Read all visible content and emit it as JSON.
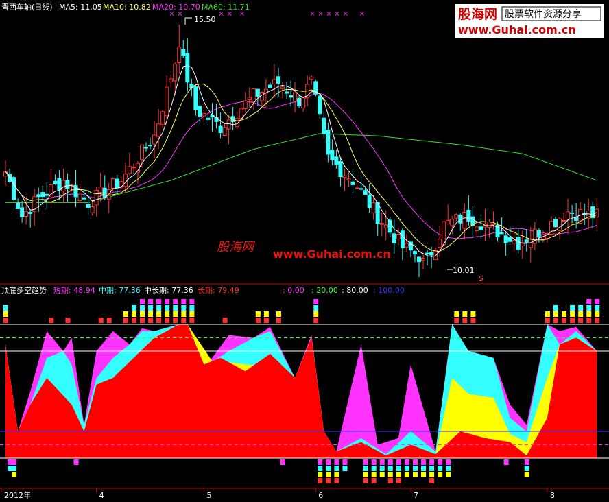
{
  "upper_panel": {
    "title": "晋西车轴(日线)",
    "ma_labels": [
      {
        "text": "MA5: 11.05",
        "color": "#ffffff"
      },
      {
        "text": "MA10: 10.82",
        "color": "#ffff66"
      },
      {
        "text": "MA20: 10.70",
        "color": "#ff33ff"
      },
      {
        "text": "MA60: 11.71",
        "color": "#33dd33"
      }
    ],
    "high_label": "15.50",
    "low_label": "10.01",
    "s_mark": "S",
    "marker_glyph": "×",
    "watermark": {
      "cn": "股海网",
      "url": "www.Guhai.com.cn"
    }
  },
  "logo": {
    "site": "股海网",
    "slogan": "股票软件资源分享",
    "url": "www.Guhai.com.cn"
  },
  "lower_panel": {
    "title": "顶底多空趋势",
    "labels": [
      {
        "text": "短期: 48.94",
        "color": "#ff33ff"
      },
      {
        "text": "中期: 77.36",
        "color": "#33ffff"
      },
      {
        "text": "中长期: 77.36",
        "color": "#ffffff"
      },
      {
        "text": "长期: 79.49",
        "color": "#ff3333"
      }
    ],
    "levels": [
      {
        "text": ": 0.00",
        "color": "#ff33ff"
      },
      {
        "text": ": 20.00",
        "color": "#33ff33"
      },
      {
        "text": ": 80.00",
        "color": "#ffffff"
      },
      {
        "text": ": 100.00",
        "color": "#3333ff"
      }
    ]
  },
  "x_axis": {
    "labels": [
      "2012年",
      "4",
      "5",
      "6",
      "7",
      "8"
    ],
    "label_index": [
      0,
      22,
      48,
      75,
      98,
      131
    ]
  },
  "chart_data": {
    "type": "candlestick",
    "bars": 144,
    "ohlc_anchors": [
      [
        0,
        12.2
      ],
      [
        4,
        11.2
      ],
      [
        8,
        11.6
      ],
      [
        14,
        12.0
      ],
      [
        20,
        11.5
      ],
      [
        28,
        12.0
      ],
      [
        36,
        13.0
      ],
      [
        42,
        15.0
      ],
      [
        46,
        13.6
      ],
      [
        52,
        13.2
      ],
      [
        60,
        13.9
      ],
      [
        66,
        14.2
      ],
      [
        71,
        13.8
      ],
      [
        74,
        14.2
      ],
      [
        78,
        12.5
      ],
      [
        84,
        12.0
      ],
      [
        90,
        11.2
      ],
      [
        96,
        10.5
      ],
      [
        102,
        10.2
      ],
      [
        106,
        11.0
      ],
      [
        112,
        11.2
      ],
      [
        118,
        10.9
      ],
      [
        124,
        10.6
      ],
      [
        130,
        10.9
      ],
      [
        136,
        11.3
      ],
      [
        143,
        11.2
      ]
    ],
    "ma60_anchors": [
      [
        0,
        11.5
      ],
      [
        20,
        11.5
      ],
      [
        40,
        12.0
      ],
      [
        60,
        12.7
      ],
      [
        76,
        13.05
      ],
      [
        90,
        13.0
      ],
      [
        110,
        12.8
      ],
      [
        125,
        12.6
      ],
      [
        143,
        12.0
      ]
    ],
    "oscillator_anchors": {
      "long": [
        [
          0,
          85
        ],
        [
          3,
          20
        ],
        [
          6,
          40
        ],
        [
          10,
          60
        ],
        [
          16,
          40
        ],
        [
          19,
          20
        ],
        [
          22,
          55
        ],
        [
          26,
          60
        ],
        [
          30,
          72
        ],
        [
          36,
          90
        ],
        [
          42,
          100
        ],
        [
          44,
          100
        ],
        [
          48,
          70
        ],
        [
          52,
          75
        ],
        [
          58,
          65
        ],
        [
          64,
          78
        ],
        [
          70,
          60
        ],
        [
          74,
          90
        ],
        [
          77,
          20
        ],
        [
          80,
          5
        ],
        [
          86,
          12
        ],
        [
          92,
          2
        ],
        [
          98,
          10
        ],
        [
          104,
          3
        ],
        [
          110,
          20
        ],
        [
          116,
          15
        ],
        [
          122,
          12
        ],
        [
          126,
          2
        ],
        [
          131,
          30
        ],
        [
          134,
          85
        ],
        [
          138,
          90
        ],
        [
          143,
          80
        ]
      ],
      "mid": [
        [
          0,
          85
        ],
        [
          3,
          20
        ],
        [
          6,
          40
        ],
        [
          10,
          75
        ],
        [
          14,
          80
        ],
        [
          16,
          70
        ],
        [
          19,
          25
        ],
        [
          22,
          60
        ],
        [
          26,
          75
        ],
        [
          30,
          85
        ],
        [
          33,
          95
        ],
        [
          36,
          95
        ],
        [
          42,
          100
        ],
        [
          44,
          100
        ],
        [
          50,
          72
        ],
        [
          54,
          80
        ],
        [
          60,
          90
        ],
        [
          64,
          95
        ],
        [
          70,
          60
        ],
        [
          74,
          90
        ],
        [
          77,
          20
        ],
        [
          80,
          5
        ],
        [
          86,
          15
        ],
        [
          92,
          3
        ],
        [
          98,
          20
        ],
        [
          104,
          5
        ],
        [
          108,
          100
        ],
        [
          112,
          80
        ],
        [
          118,
          75
        ],
        [
          122,
          30
        ],
        [
          126,
          20
        ],
        [
          131,
          100
        ],
        [
          134,
          85
        ],
        [
          138,
          95
        ],
        [
          143,
          80
        ]
      ],
      "short": [
        [
          0,
          85
        ],
        [
          3,
          20
        ],
        [
          6,
          50
        ],
        [
          10,
          95
        ],
        [
          14,
          80
        ],
        [
          16,
          90
        ],
        [
          19,
          25
        ],
        [
          22,
          80
        ],
        [
          26,
          95
        ],
        [
          30,
          85
        ],
        [
          33,
          97
        ],
        [
          36,
          95
        ],
        [
          42,
          100
        ],
        [
          44,
          100
        ],
        [
          48,
          70
        ],
        [
          50,
          75
        ],
        [
          54,
          92
        ],
        [
          60,
          90
        ],
        [
          64,
          98
        ],
        [
          70,
          60
        ],
        [
          74,
          92
        ],
        [
          77,
          20
        ],
        [
          80,
          5
        ],
        [
          86,
          85
        ],
        [
          90,
          10
        ],
        [
          95,
          15
        ],
        [
          98,
          70
        ],
        [
          104,
          5
        ],
        [
          108,
          100
        ],
        [
          112,
          80
        ],
        [
          118,
          75
        ],
        [
          122,
          40
        ],
        [
          126,
          25
        ],
        [
          131,
          100
        ],
        [
          134,
          95
        ],
        [
          138,
          98
        ],
        [
          143,
          80
        ]
      ]
    }
  },
  "colors": {
    "up": "#ff3333",
    "down": "#33ffff",
    "ma5": "#ffffff",
    "ma10": "#ffff66",
    "ma20": "#ff33ff",
    "ma60": "#33dd33",
    "long": "#ff0000",
    "mid": "#ffff00",
    "midlong": "#33ffff",
    "short": "#ff33ff",
    "axis": "#cc0000"
  }
}
